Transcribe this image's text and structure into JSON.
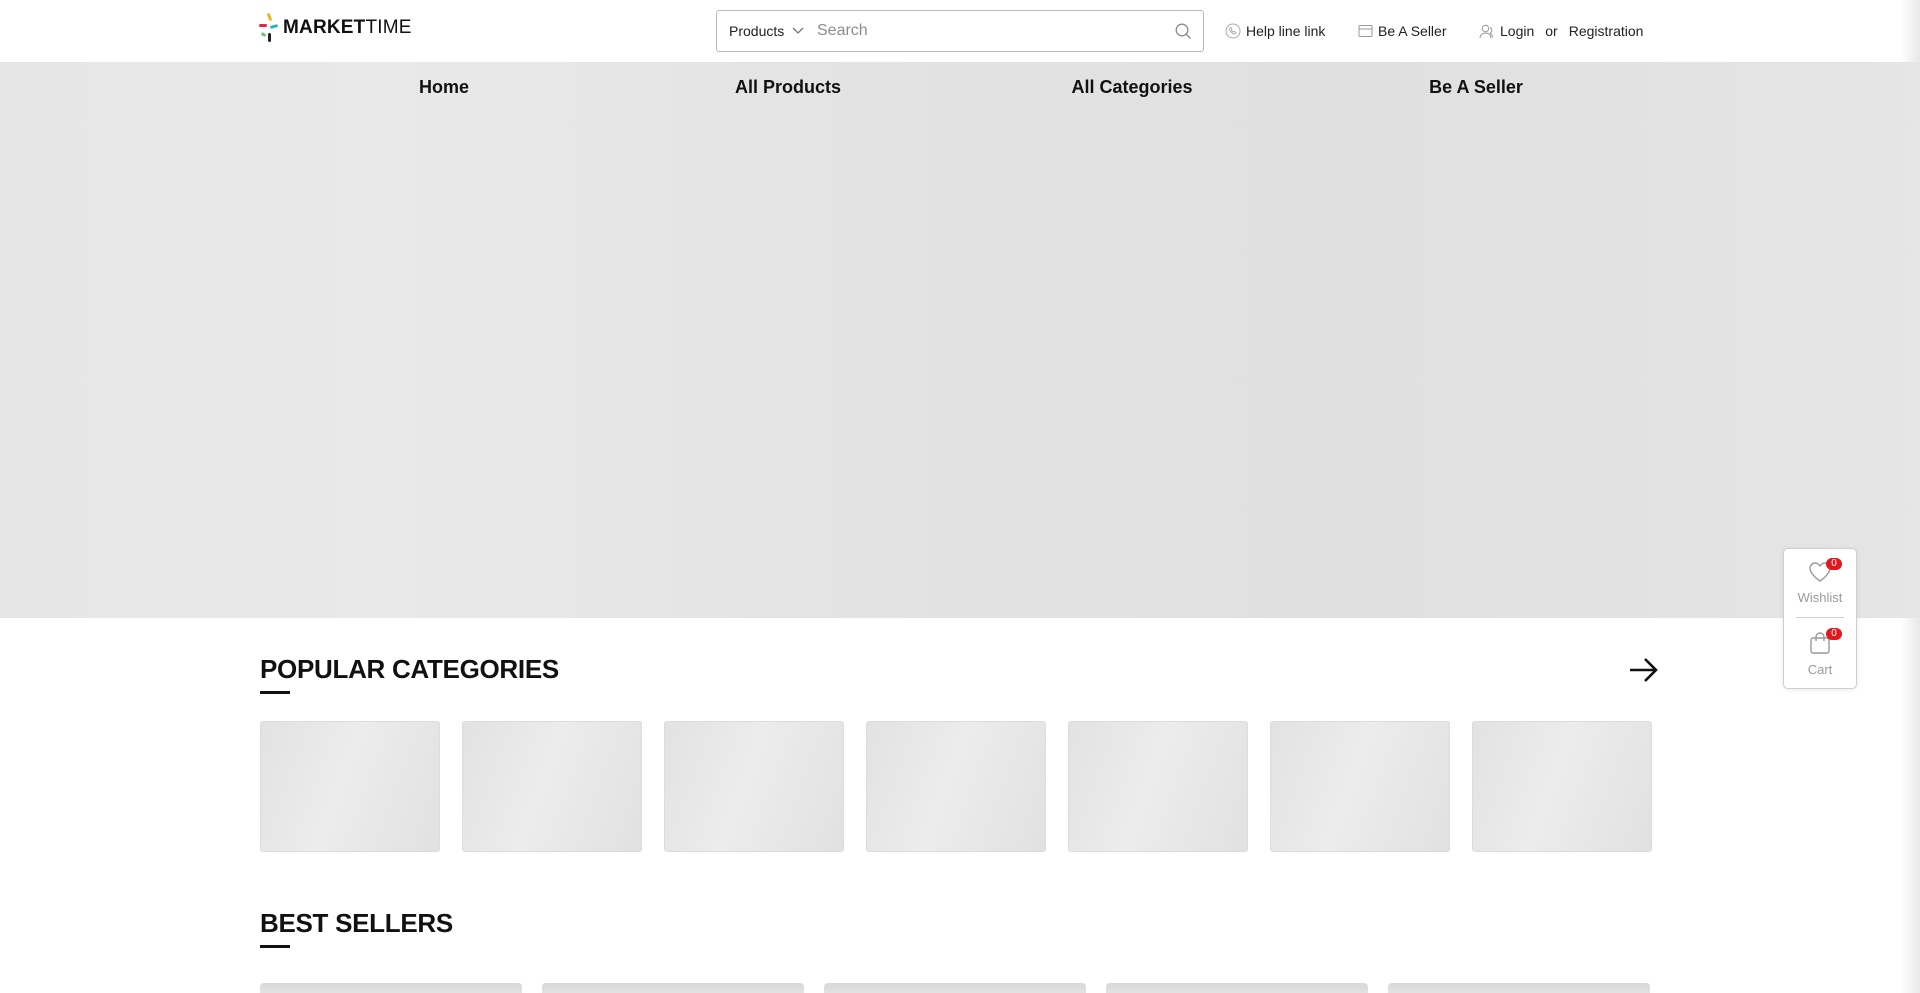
{
  "brand": {
    "name_bold": "MARKET",
    "name_light": "TIME"
  },
  "search": {
    "category": "Products",
    "placeholder": "Search"
  },
  "top_links": {
    "help": "Help line link",
    "seller": "Be A Seller",
    "login": "Login",
    "or": "or",
    "register": "Registration"
  },
  "nav": {
    "items": [
      "Home",
      "All Products",
      "All Categories",
      "Be A Seller"
    ]
  },
  "sections": {
    "popular": "POPULAR CATEGORIES",
    "best": "BEST SELLERS"
  },
  "floating": {
    "wishlist_label": "Wishlist",
    "wishlist_count": "0",
    "cart_label": "Cart",
    "cart_count": "0"
  },
  "colors": {
    "badge": "#e3181e",
    "hero_bg": "#e4e4e4"
  }
}
